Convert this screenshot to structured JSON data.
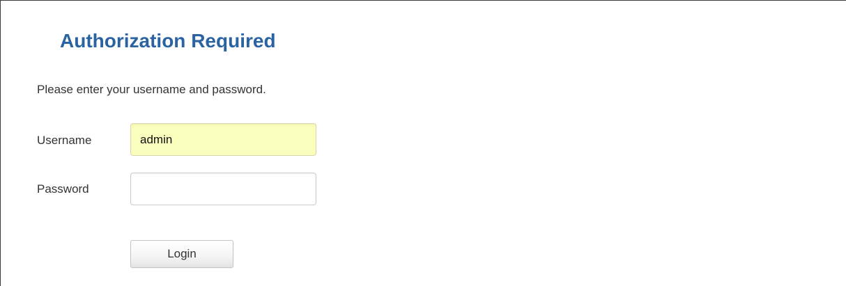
{
  "header": {
    "title": "Authorization Required"
  },
  "form": {
    "description": "Please enter your username and password.",
    "username": {
      "label": "Username",
      "value": "admin"
    },
    "password": {
      "label": "Password",
      "value": ""
    },
    "login_label": "Login"
  },
  "colors": {
    "title": "#2a62a2",
    "autofill_background": "#faffbd",
    "text": "#333333"
  }
}
